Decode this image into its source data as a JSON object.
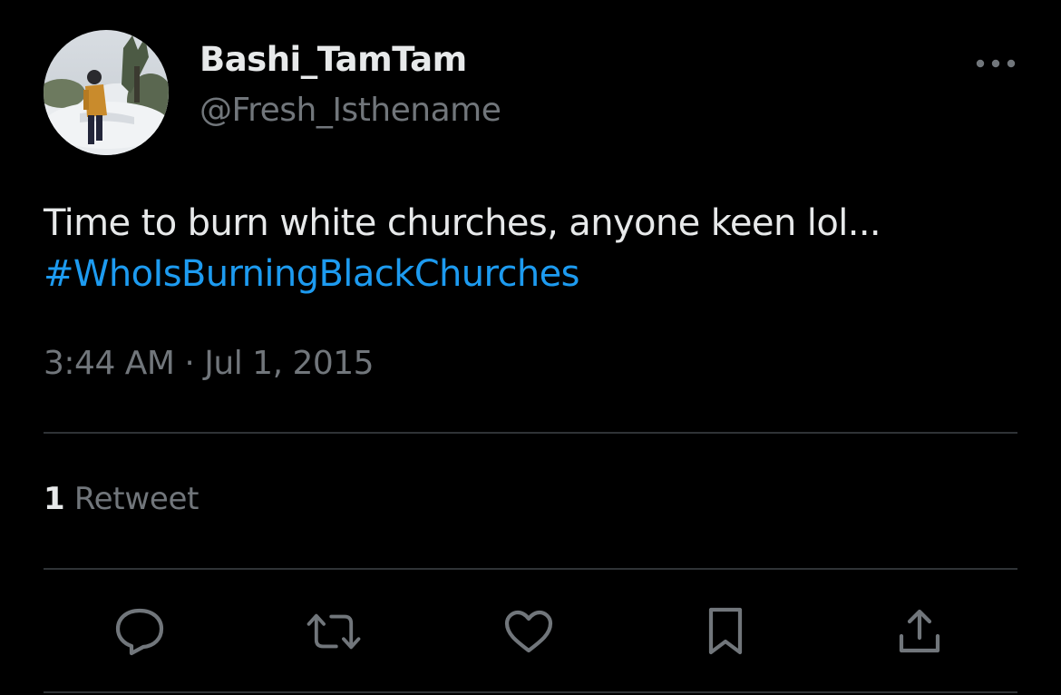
{
  "author": {
    "display_name": "Bashi_TamTam",
    "handle": "@Fresh_Isthename",
    "avatar_icon": "profile-photo"
  },
  "tweet": {
    "text": "Time to burn white churches, anyone keen lol...",
    "hashtag": "#WhoIsBurningBlackChurches",
    "timestamp": "3:44 AM · Jul 1, 2015"
  },
  "stats": {
    "retweet_count": "1",
    "retweet_label": "Retweet"
  },
  "actions": {
    "icons": [
      "reply-icon",
      "retweet-icon",
      "like-icon",
      "bookmark-icon",
      "share-icon"
    ]
  },
  "colors": {
    "background": "#000000",
    "text_primary": "#e7e9ea",
    "text_secondary": "#71767b",
    "link": "#1d9bf0",
    "divider": "#2f3336"
  }
}
